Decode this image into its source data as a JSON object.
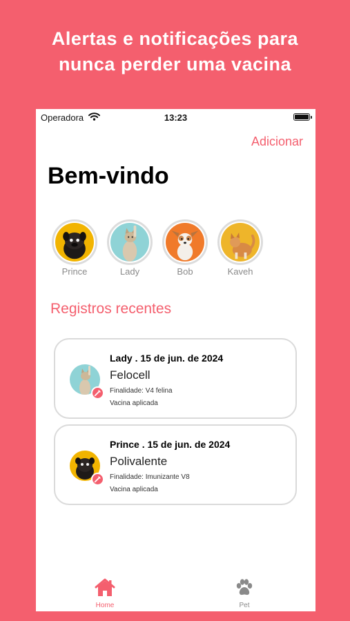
{
  "promo": {
    "line1": "Alertas e notificações para",
    "line2": "nunca perder uma vacina"
  },
  "status_bar": {
    "carrier": "Operadora",
    "time": "13:23"
  },
  "header": {
    "add_label": "Adicionar",
    "welcome": "Bem-vindo"
  },
  "pets": [
    {
      "name": "Prince",
      "bg": "#f2b400"
    },
    {
      "name": "Lady",
      "bg": "#8fd3d6"
    },
    {
      "name": "Bob",
      "bg": "#f07a2a"
    },
    {
      "name": "Kaveh",
      "bg": "#eeb52a"
    }
  ],
  "recent": {
    "title": "Registros recentes",
    "records": [
      {
        "heading": "Lady . 15 de jun. de 2024",
        "vaccine": "Felocell",
        "purpose": "Finalidade: V4 felina",
        "status": "Vacina aplicada"
      },
      {
        "heading": "Prince . 15 de jun. de 2024",
        "vaccine": "Polivalente",
        "purpose": "Finalidade: Imunizante V8",
        "status": "Vacina aplicada"
      }
    ]
  },
  "tabs": [
    {
      "label": "Home",
      "icon": "home-icon",
      "active": true
    },
    {
      "label": "Pet",
      "icon": "paw-icon",
      "active": false
    }
  ],
  "colors": {
    "accent": "#f45f6e",
    "muted": "#8a8a8a"
  }
}
